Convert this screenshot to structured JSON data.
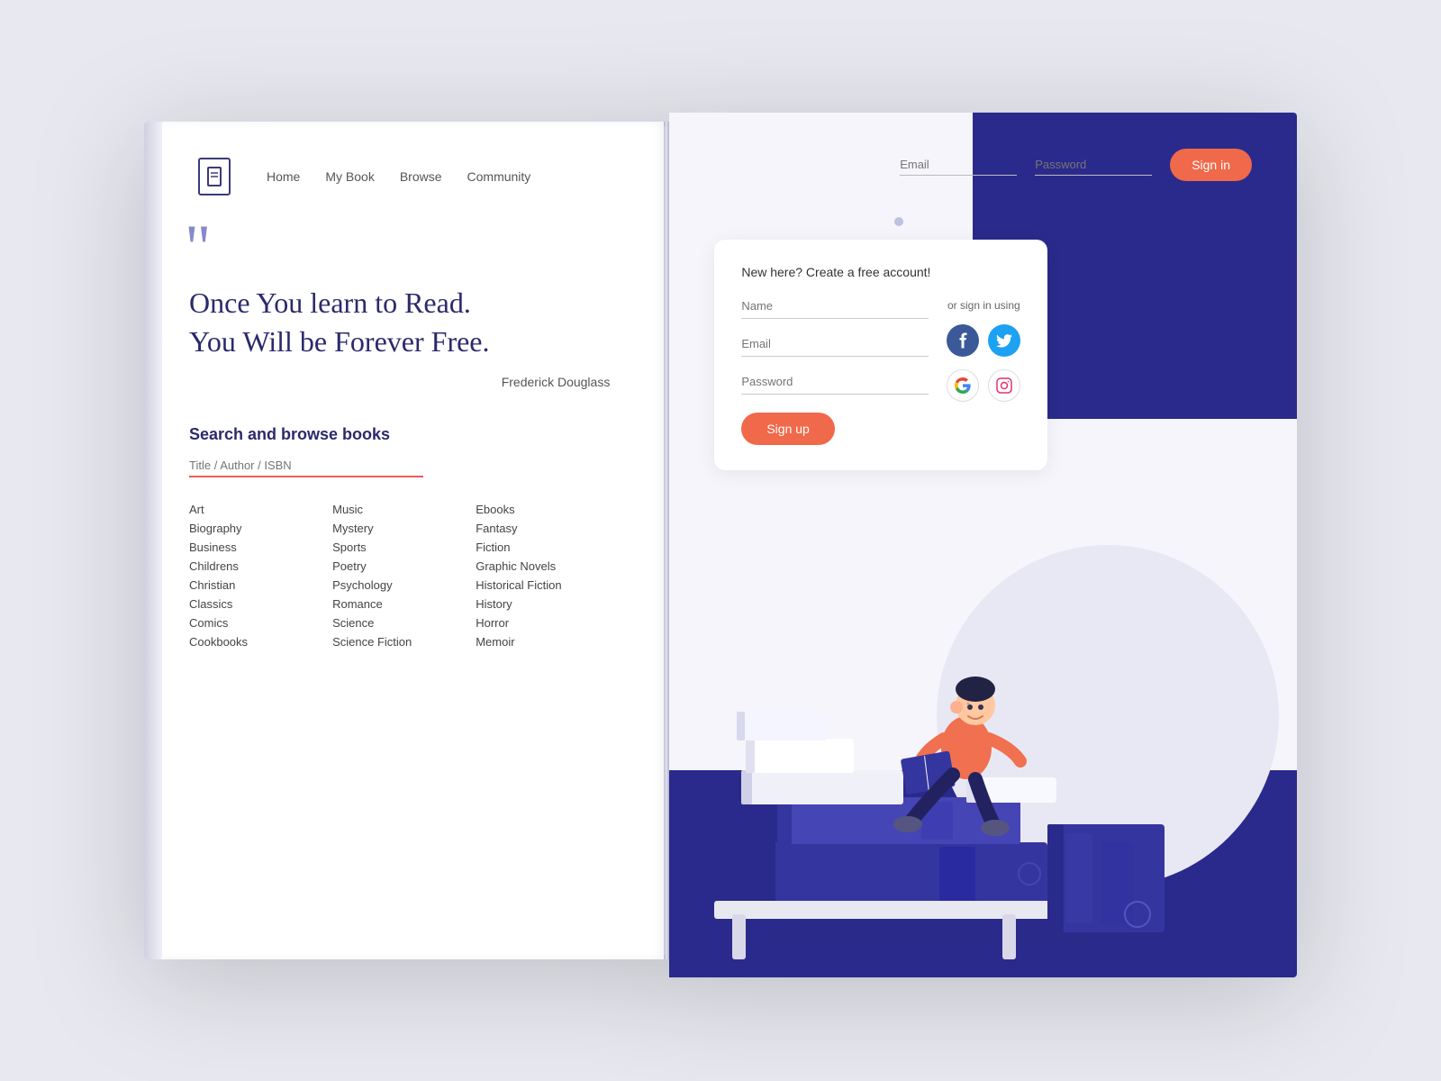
{
  "nav": {
    "logo_alt": "Book logo",
    "links": [
      "Home",
      "My Book",
      "Browse",
      "Community"
    ]
  },
  "quote": {
    "mark": "”",
    "text_line1": "Once You learn to Read.",
    "text_line2": "You Will be Forever Free.",
    "author": "Frederick Douglass"
  },
  "search": {
    "title": "Search and browse books",
    "placeholder": "Title / Author / ISBN"
  },
  "categories": {
    "col1": [
      "Art",
      "Biography",
      "Business",
      "Childrens",
      "Christian",
      "Classics",
      "Comics",
      "Cookbooks"
    ],
    "col2": [
      "Music",
      "Mystery",
      "Sports",
      "Poetry",
      "Psychology",
      "Romance",
      "Science",
      "Science Fiction"
    ],
    "col3": [
      "Ebooks",
      "Fantasy",
      "Fiction",
      "Graphic Novels",
      "Historical Fiction",
      "History",
      "Horror",
      "Memoir"
    ]
  },
  "auth": {
    "email_placeholder": "Email",
    "password_placeholder": "Password",
    "signin_label": "Sign in"
  },
  "signup": {
    "title": "New here? Create a free account!",
    "name_placeholder": "Name",
    "email_placeholder": "Email",
    "password_placeholder": "Password",
    "button_label": "Sign up",
    "social_label": "or sign in using",
    "social_icons": [
      "facebook",
      "twitter",
      "google",
      "instagram"
    ]
  }
}
